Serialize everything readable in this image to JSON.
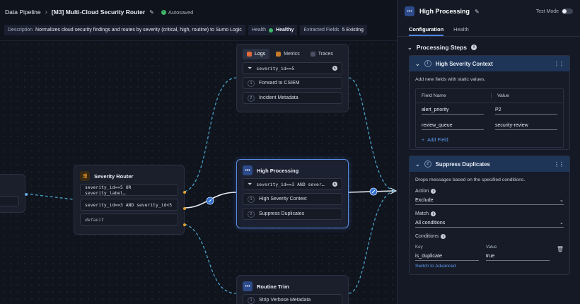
{
  "topbar": {
    "breadcrumb_root": "Data Pipeline",
    "pipeline_title": "[M3] Multi-Cloud Security Router",
    "autosaved": "Autosaved"
  },
  "infobar": {
    "description_label": "Description",
    "description_value": "Normalizes cloud security findings and routes by severity (critical, high, routine) to Sumo Logic",
    "health_label": "Health",
    "health_value": "Healthy",
    "extracted_label": "Extracted Fields",
    "extracted_value": "5 Existing"
  },
  "nodes": {
    "output_tabs": [
      "Logs",
      "Metrics",
      "Traces"
    ],
    "critical_filter": "severity_id==5",
    "critical_steps": [
      "Forward to CSIEM",
      "Incident Metadata"
    ],
    "router_title": "Severity Router",
    "router_routes": [
      "severity_id==5 OR severity_label…",
      "severity_id==3 AND severity_id<5",
      "default"
    ],
    "high_title": "High Processing",
    "high_filter": "severity_id==3 AND sever…",
    "high_steps": [
      "High Severity Context",
      "Suppress Duplicates"
    ],
    "routine_title": "Routine Trim",
    "routine_steps": [
      "Strip Verbose Metadata"
    ]
  },
  "panel": {
    "title": "High Processing",
    "test_mode": "Test Mode",
    "tabs": [
      "Configuration",
      "Health"
    ],
    "section_title": "Processing Steps",
    "step1": {
      "number": "1",
      "title": "High Severity Context",
      "description": "Add new fields with static values.",
      "col_name": "Field Name",
      "col_value": "Value",
      "rows": [
        {
          "name": "alert_priority",
          "value": "P2"
        },
        {
          "name": "review_queue",
          "value": "security-review"
        }
      ],
      "add_field": "Add Field"
    },
    "step2": {
      "number": "2",
      "title": "Suppress Duplicates",
      "description": "Drops messages based on the specified conditions.",
      "action_label": "Action",
      "action_value": "Exclude",
      "match_label": "Match",
      "match_value": "All conditions",
      "conditions_label": "Conditions",
      "key_label": "Key",
      "key_value": "is_duplicate",
      "value_label": "Value",
      "value_value": "true",
      "switch_link": "Switch to Advanced"
    }
  },
  "colors": {
    "accent": "#4d86e6",
    "edge": "#4aa3c8",
    "healthy": "#3fb86b",
    "port_orange": "#e5a030"
  }
}
